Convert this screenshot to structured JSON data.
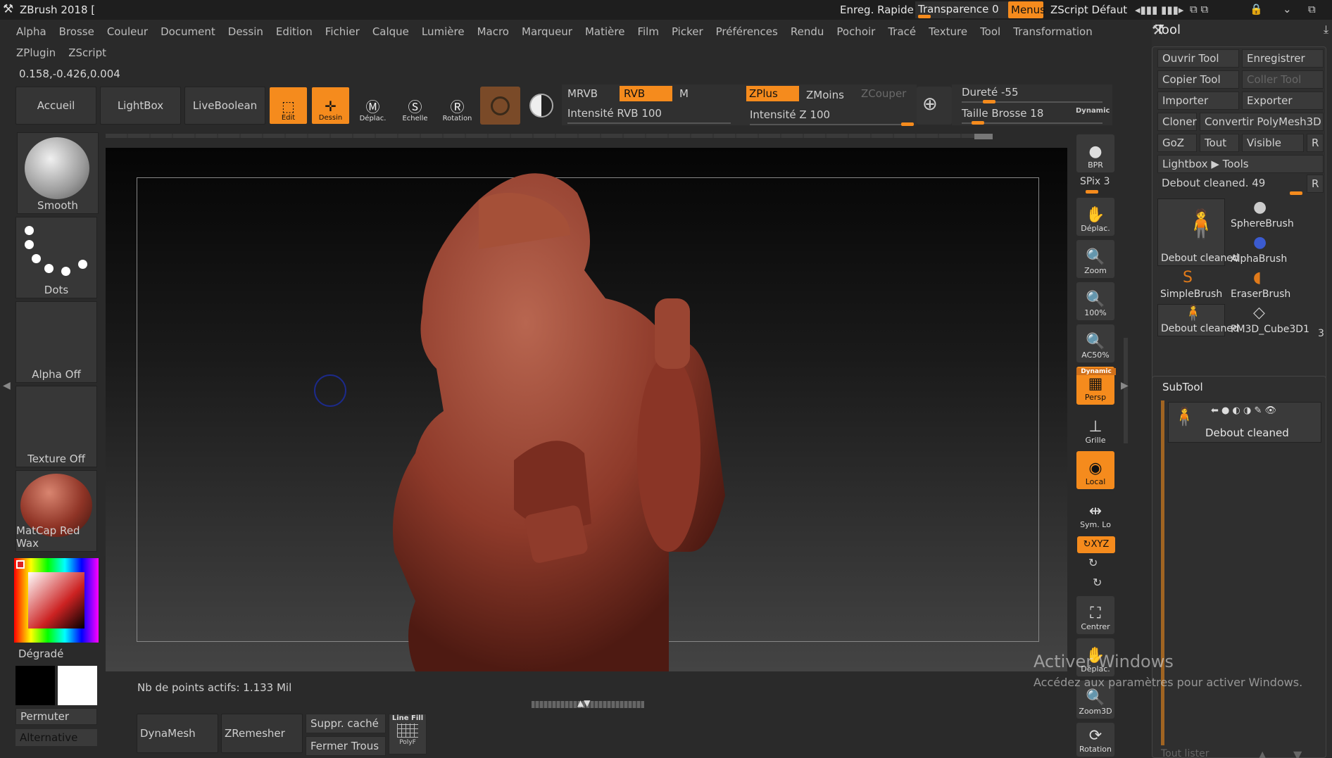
{
  "titlebar": {
    "app_title": "ZBrush 2018 [",
    "enreg": "Enreg. Rapide",
    "transparence": "Transparence 0",
    "menus": "Menus",
    "zscript": "ZScript Défaut"
  },
  "menu": [
    "Alpha",
    "Brosse",
    "Couleur",
    "Document",
    "Dessin",
    "Edition",
    "Fichier",
    "Calque",
    "Lumière",
    "Macro",
    "Marqueur",
    "Matière",
    "Film",
    "Picker",
    "Préférences",
    "Rendu",
    "Pochoir",
    "Tracé",
    "Texture",
    "Tool",
    "Transformation"
  ],
  "menu2": [
    "ZPlugin",
    "ZScript"
  ],
  "coords": "0.158,-0.426,0.004",
  "toolbar": {
    "accueil": "Accueil",
    "lightbox": "LightBox",
    "liveboolean": "LiveBoolean",
    "edit": "Edit",
    "dessin": "Dessin",
    "deplac": "Déplac.",
    "echelle": "Echelle",
    "rotation": "Rotation",
    "mrvb": "MRVB",
    "rvb": "RVB",
    "m": "M",
    "intensite_rvb": "Intensité RVB 100",
    "zplus": "ZPlus",
    "zmoins": "ZMoins",
    "zcouper": "ZCouper",
    "intensite_z": "Intensité Z 100",
    "durete": "Dureté -55",
    "taille": "Taille Brosse 18",
    "dynamic": "Dynamic"
  },
  "left": {
    "smooth": "Smooth",
    "dots": "Dots",
    "alpha_off": "Alpha Off",
    "texture_off": "Texture Off",
    "matcap": "MatCap Red Wax",
    "degrade": "Dégradé",
    "permuter": "Permuter",
    "alternative": "Alternative"
  },
  "viewport": {
    "points": "Nb de points actifs: 1.133 Mil"
  },
  "bottom": {
    "dynamesh": "DynaMesh",
    "zremesher": "ZRemesher",
    "suppr": "Suppr. caché",
    "fermer": "Fermer Trous",
    "linefill": "Line Fill",
    "polyf": "PolyF"
  },
  "right_shelf": {
    "bpr": "BPR",
    "spix": "SPix 3",
    "deplac": "Déplac.",
    "zoom": "Zoom",
    "p100": "100%",
    "ac50": "AC50%",
    "dynamic": "Dynamic",
    "persp": "Persp",
    "grille": "Grille",
    "local": "Local",
    "sym": "Sym. Lo",
    "xyz": "XYZ",
    "centrer": "Centrer",
    "deplac2": "Déplac.",
    "zoom3d": "Zoom3D",
    "rotation": "Rotation"
  },
  "tool": {
    "title": "Tool",
    "ouvrir": "Ouvrir Tool",
    "enregistrer": "Enregistrer",
    "copier": "Copier Tool",
    "coller": "Coller Tool",
    "importer": "Importer",
    "exporter": "Exporter",
    "cloner": "Cloner",
    "convertir": "Convertir PolyMesh3D",
    "goz": "GoZ",
    "tout": "Tout",
    "visible": "Visible",
    "r": "R",
    "lightbox_tools": "Lightbox ▶ Tools",
    "debout_slider": "Debout cleaned. 49",
    "thumbs": [
      "Debout cleaned",
      "SphereBrush",
      "AlphaBrush",
      "SimpleBrush",
      "EraserBrush",
      "Debout cleaned",
      "PM3D_Cube3D1"
    ],
    "count": "3",
    "subtool": "SubTool",
    "subtool_item": "Debout cleaned",
    "tout_lister": "Tout lister"
  },
  "watermark": {
    "line1": "Activer Windows",
    "line2": "Accédez aux paramètres pour activer Windows."
  }
}
